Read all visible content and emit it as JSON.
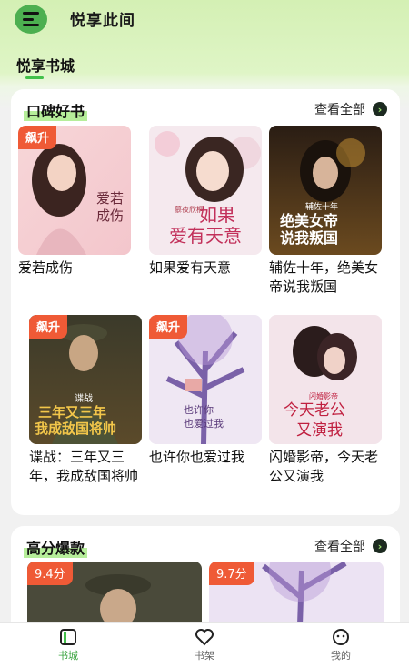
{
  "app": {
    "title": "悦享此间"
  },
  "tabs": [
    {
      "label": "悦享书城"
    }
  ],
  "sections": [
    {
      "title": "口碑好书",
      "more_label": "查看全部",
      "books": [
        {
          "title": "爱若成伤",
          "badge": "飙升"
        },
        {
          "title": "如果爱有天意",
          "badge": ""
        },
        {
          "title": "辅佐十年，绝美女帝说我叛国",
          "badge": ""
        },
        {
          "title": "谍战：三年又三年，我成敌国将帅",
          "badge": "飙升"
        },
        {
          "title": "也许你也爱过我",
          "badge": "飙升"
        },
        {
          "title": "闪婚影帝，今天老公又演我",
          "badge": ""
        }
      ]
    },
    {
      "title": "高分爆款",
      "more_label": "查看全部",
      "books": [
        {
          "score": "9.4分"
        },
        {
          "score": "9.7分"
        }
      ]
    }
  ],
  "bottom_nav": [
    {
      "label": "书城",
      "icon": "bookstore-icon",
      "active": true
    },
    {
      "label": "书架",
      "icon": "heart-icon",
      "active": false
    },
    {
      "label": "我的",
      "icon": "profile-icon",
      "active": false
    }
  ],
  "colors": {
    "accent": "#43c04a",
    "badge": "#ef5a36",
    "header_bg": "#d4f0b4"
  }
}
